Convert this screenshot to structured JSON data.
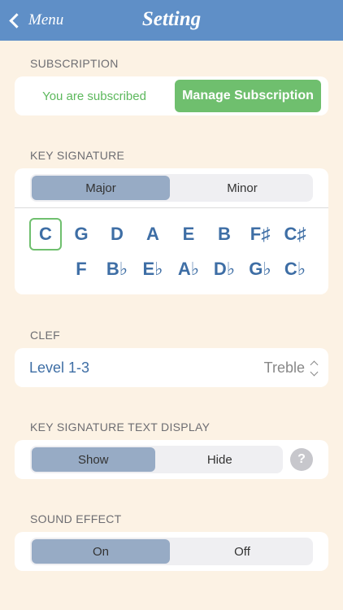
{
  "nav": {
    "back_label": "Menu",
    "title": "Setting"
  },
  "subscription": {
    "header": "SUBSCRIPTION",
    "status_text": "You are subscribed",
    "manage_label": "Manage Subscription"
  },
  "key_signature": {
    "header": "KEY SIGNATURE",
    "modes": [
      "Major",
      "Minor"
    ],
    "selected_mode": "Major",
    "row1": [
      "C",
      "G",
      "D",
      "A",
      "E",
      "B",
      "F♯",
      "C♯"
    ],
    "row2": [
      "F",
      "B♭",
      "E♭",
      "A♭",
      "D♭",
      "G♭",
      "C♭"
    ],
    "selected_key": "C"
  },
  "clef": {
    "header": "CLEF",
    "level": "Level 1-3",
    "value": "Treble"
  },
  "text_display": {
    "header": "KEY SIGNATURE TEXT DISPLAY",
    "options": [
      "Show",
      "Hide"
    ],
    "selected": "Show",
    "help_label": "?"
  },
  "sound_effect": {
    "header": "SOUND EFFECT",
    "options": [
      "On",
      "Off"
    ],
    "selected": "On"
  },
  "colors": {
    "nav_bar": "#5f8fc7",
    "background": "#fcf2e4",
    "accent_green": "#6fbf6e",
    "key_blue": "#3e6ea5",
    "segment_active": "#97abc5"
  }
}
